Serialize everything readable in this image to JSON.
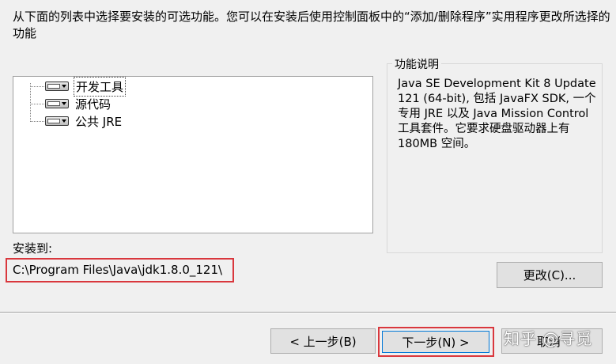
{
  "instructions": "从下面的列表中选择要安装的可选功能。您可以在安装后使用控制面板中的“添加/删除程序”实用程序更改所选择的功能",
  "features": [
    {
      "label": "开发工具",
      "icon": "feature-drive-dropdown-icon",
      "selected": true
    },
    {
      "label": "源代码",
      "icon": "feature-drive-dropdown-icon",
      "selected": false
    },
    {
      "label": "公共 JRE",
      "icon": "feature-drive-dropdown-icon",
      "selected": false
    }
  ],
  "description_group": {
    "title": "功能说明",
    "text": "Java SE Development Kit 8 Update 121 (64-bit), 包括 JavaFX SDK, 一个专用 JRE 以及 Java Mission Control 工具套件。它要求硬盘驱动器上有 180MB 空间。"
  },
  "install_to": {
    "label": "安装到:",
    "path": "C:\\Program Files\\Java\\jdk1.8.0_121\\"
  },
  "buttons": {
    "change": "更改(C)...",
    "back": "< 上一步(B)",
    "next": "下一步(N) >",
    "cancel": "取消"
  },
  "watermark": "知乎 @寻觅",
  "colors": {
    "highlight_outline": "#d9373d",
    "window_background": "#f0f0f0",
    "default_button_border": "#0078d7"
  }
}
